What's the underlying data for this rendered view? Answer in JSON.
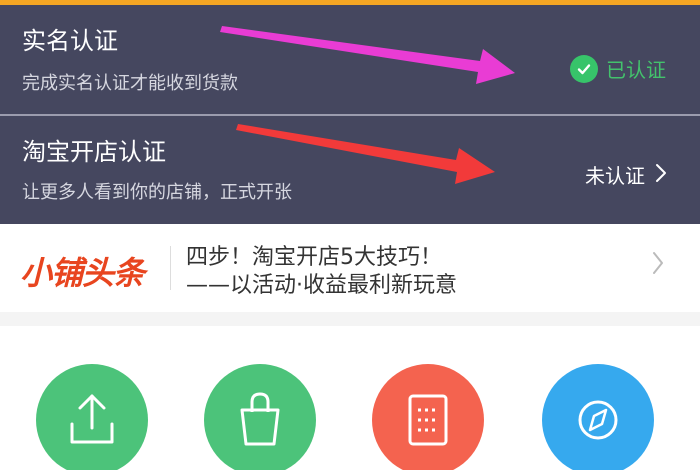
{
  "rows": [
    {
      "title": "实名认证",
      "desc": "完成实名认证才能收到货款",
      "status": "已认证",
      "status_icon": "check-circle-icon",
      "status_color": "#43c26c"
    },
    {
      "title": "淘宝开店认证",
      "desc": "让更多人看到你的店铺，正式开张",
      "status": "未认证",
      "status_icon": "chevron-right-icon"
    }
  ],
  "news": {
    "logo": "小铺头条",
    "headline": "四步！淘宝开店5大技巧！",
    "subline": "——以活动·收益最利新玩意"
  },
  "quick_icons": [
    {
      "icon": "upload-icon",
      "color": "#4cc37a"
    },
    {
      "icon": "shopping-bag-icon",
      "color": "#4cc37a"
    },
    {
      "icon": "document-icon",
      "color": "#f4634f"
    },
    {
      "icon": "compass-icon",
      "color": "#36a9ee"
    }
  ],
  "colors": {
    "header_bg": "#45475f",
    "accent_top": "#f5a623",
    "arrow_pink": "#e93cd4",
    "arrow_red": "#f23a3a"
  }
}
